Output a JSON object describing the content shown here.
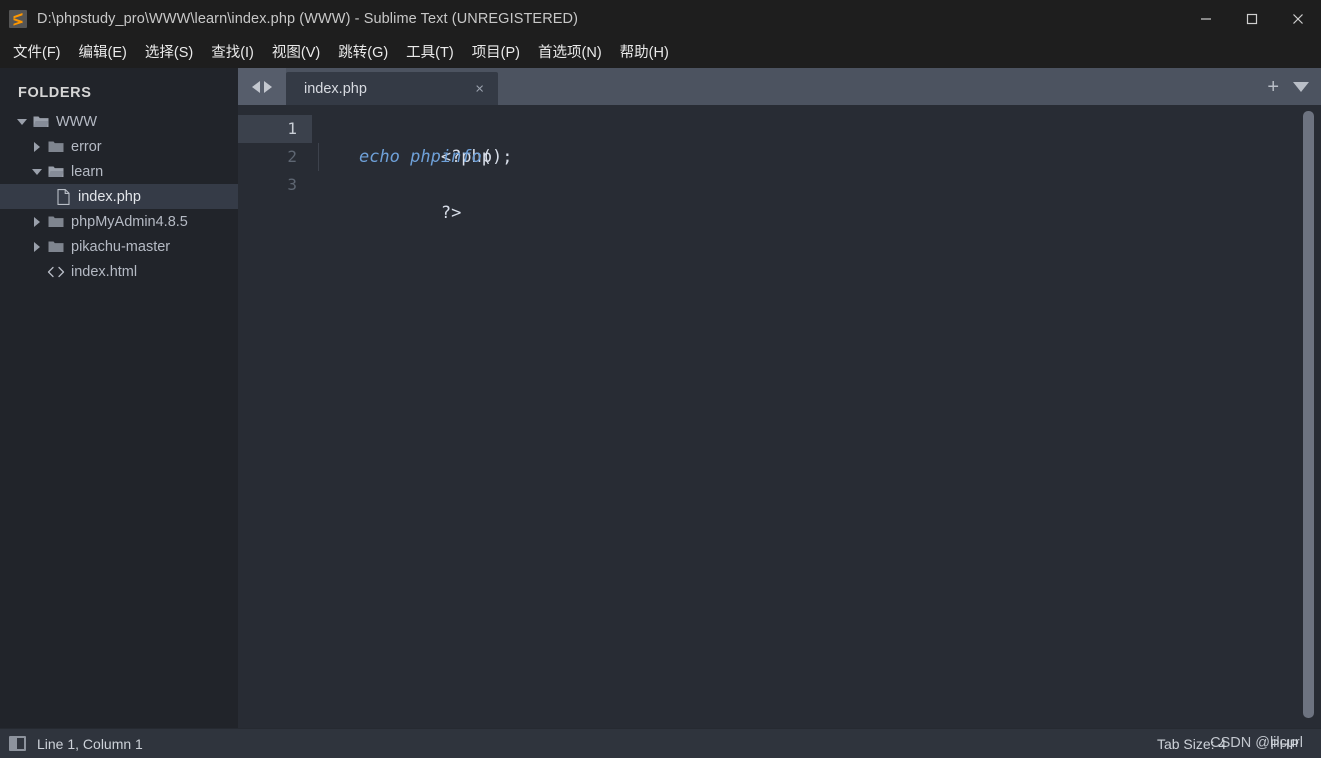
{
  "window": {
    "title": "D:\\phpstudy_pro\\WWW\\learn\\index.php (WWW) - Sublime Text (UNREGISTERED)",
    "logo_icon": "sublime-text-logo",
    "controls": {
      "minimize": "—",
      "maximize": "□",
      "close": "✕"
    },
    "accent": "#ff9800"
  },
  "menubar": {
    "items": [
      {
        "label": "文件(F)"
      },
      {
        "label": "编辑(E)"
      },
      {
        "label": "选择(S)"
      },
      {
        "label": "查找(I)"
      },
      {
        "label": "视图(V)"
      },
      {
        "label": "跳转(G)"
      },
      {
        "label": "工具(T)"
      },
      {
        "label": "项目(P)"
      },
      {
        "label": "首选项(N)"
      },
      {
        "label": "帮助(H)"
      }
    ]
  },
  "sidebar": {
    "header": "FOLDERS",
    "tree": [
      {
        "label": "WWW",
        "type": "folder-open",
        "level": 0,
        "twisty": "down",
        "selected": false
      },
      {
        "label": "error",
        "type": "folder-closed",
        "level": 1,
        "twisty": "right",
        "selected": false
      },
      {
        "label": "learn",
        "type": "folder-open",
        "level": 1,
        "twisty": "down",
        "selected": false
      },
      {
        "label": "index.php",
        "type": "file",
        "level": 2,
        "twisty": "none",
        "selected": true
      },
      {
        "label": "phpMyAdmin4.8.5",
        "type": "folder-closed",
        "level": 1,
        "twisty": "right",
        "selected": false
      },
      {
        "label": "pikachu-master",
        "type": "folder-closed",
        "level": 1,
        "twisty": "right",
        "selected": false
      },
      {
        "label": "index.html",
        "type": "code-file",
        "level": 1,
        "twisty": "none",
        "selected": false
      }
    ]
  },
  "tabbar": {
    "nav_prev_icon": "chevron-left-icon",
    "nav_next_icon": "chevron-right-icon",
    "tabs": [
      {
        "label": "index.php",
        "active": true,
        "close_icon": "×"
      }
    ],
    "new_tab_icon": "+",
    "tab_list_icon": "chevron-down-icon"
  },
  "editor": {
    "lines": [
      {
        "number": "1",
        "active": true,
        "segments": [
          {
            "text": "<?php",
            "style": "plain"
          }
        ]
      },
      {
        "number": "2",
        "active": false,
        "segments": [
          {
            "text": "    ",
            "style": "plain"
          },
          {
            "text": "echo phpinfo",
            "style": "keyword"
          },
          {
            "text": "();",
            "style": "plain"
          }
        ]
      },
      {
        "number": "3",
        "active": false,
        "segments": [
          {
            "text": "?>",
            "style": "plain"
          }
        ]
      }
    ],
    "code_text_line1": "<?php",
    "code_text_line2_indent": "    ",
    "code_text_line2_kw": "echo phpinfo",
    "code_text_line2_rest": "();",
    "code_text_line3": "?>",
    "keyword_color": "#6ea0d8",
    "plain_color": "#d8dee9"
  },
  "statusbar": {
    "sidebar_toggle_icon": "sidebar-toggle-icon",
    "cursor_position": "Line 1, Column 1",
    "tab_size": "Tab Size: 4",
    "syntax": "PHP"
  },
  "watermark": {
    "text": "CSDN @lilcurl"
  }
}
